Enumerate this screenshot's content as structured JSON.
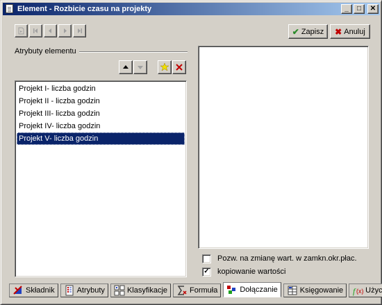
{
  "window": {
    "title": "Element - Rozbicie czasu na projekty",
    "minimize_label": "_",
    "maximize_label": "□",
    "close_label": "✕"
  },
  "toolbar": {
    "save_label": "Zapisz",
    "cancel_label": "Anuluj",
    "save_icon": "check-icon",
    "cancel_icon": "x-icon"
  },
  "attributes": {
    "group_label": "Atrybuty elementu",
    "items": [
      {
        "label": "Projekt I- liczba godzin",
        "selected": false
      },
      {
        "label": "Projekt II - liczba godzin",
        "selected": false
      },
      {
        "label": "Projekt III- liczba godzin",
        "selected": false
      },
      {
        "label": "Projekt IV- liczba godzin",
        "selected": false
      },
      {
        "label": "Projekt V- liczba godzin",
        "selected": true
      }
    ]
  },
  "options": {
    "allow_change_label": "Pozw. na zmianę wart. w zamkn.okr.płac.",
    "allow_change_checked": false,
    "copy_values_label": "kopiowanie wartości",
    "copy_values_checked": true
  },
  "tabs": [
    {
      "label": "Składnik",
      "icon": "skladnik-icon",
      "active": false
    },
    {
      "label": "Atrybuty",
      "icon": "attributes-icon",
      "active": false
    },
    {
      "label": "Klasyfikacje",
      "icon": "classification-icon",
      "active": false
    },
    {
      "label": "Formuła",
      "icon": "formula-icon",
      "active": false
    },
    {
      "label": "Dołączanie",
      "icon": "attach-icon",
      "active": true
    },
    {
      "label": "Księgowanie",
      "icon": "ledger-icon",
      "active": false
    },
    {
      "label": "Użycie",
      "icon": "function-icon",
      "active": false
    }
  ],
  "colors": {
    "title_start": "#0a246a",
    "title_end": "#a6caf0",
    "selection": "#0a246a",
    "face": "#d4d0c8"
  }
}
